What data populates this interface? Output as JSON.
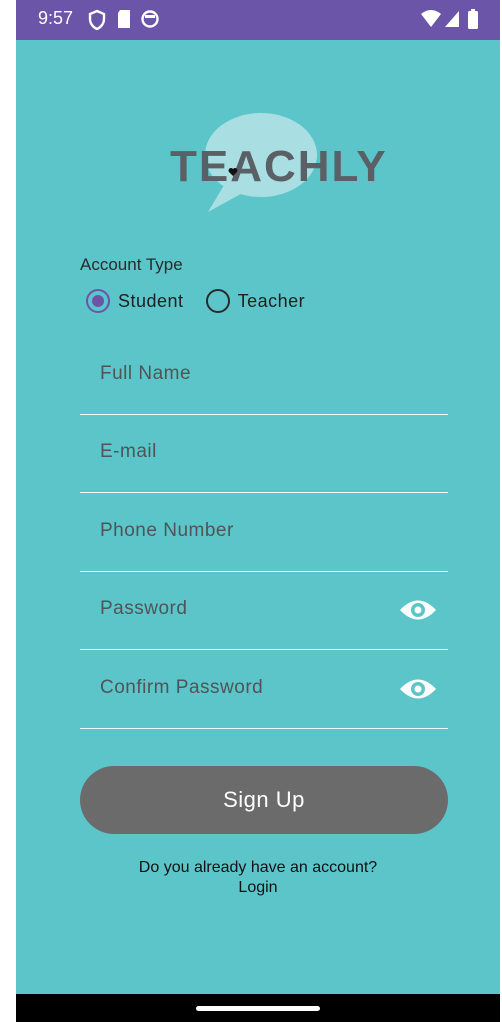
{
  "status_bar": {
    "time": "9:57",
    "icons": [
      "shield-icon",
      "sd-card-icon",
      "circle-app-icon"
    ],
    "right_icons": [
      "wifi-icon",
      "signal-icon",
      "battery-icon"
    ]
  },
  "logo": {
    "text": "TEACHLY",
    "bubble_color": "#a9dfe2",
    "text_color": "#5a6066"
  },
  "account_type": {
    "label": "Account Type",
    "options": [
      {
        "label": "Student",
        "selected": true
      },
      {
        "label": "Teacher",
        "selected": false
      }
    ]
  },
  "form": {
    "full_name": {
      "placeholder": "Full Name",
      "value": ""
    },
    "email": {
      "placeholder": "E-mail",
      "value": ""
    },
    "phone": {
      "placeholder": "Phone Number",
      "value": ""
    },
    "password": {
      "placeholder": "Password",
      "value": ""
    },
    "confirm_password": {
      "placeholder": "Confirm Password",
      "value": ""
    }
  },
  "signup_button": {
    "label": "Sign Up"
  },
  "login": {
    "prompt": "Do you already have an account?",
    "link": "Login"
  },
  "colors": {
    "background": "#5cc5ca",
    "status_bar": "#6a55a8",
    "button": "#6b6b6b",
    "accent": "#6a55a8"
  }
}
